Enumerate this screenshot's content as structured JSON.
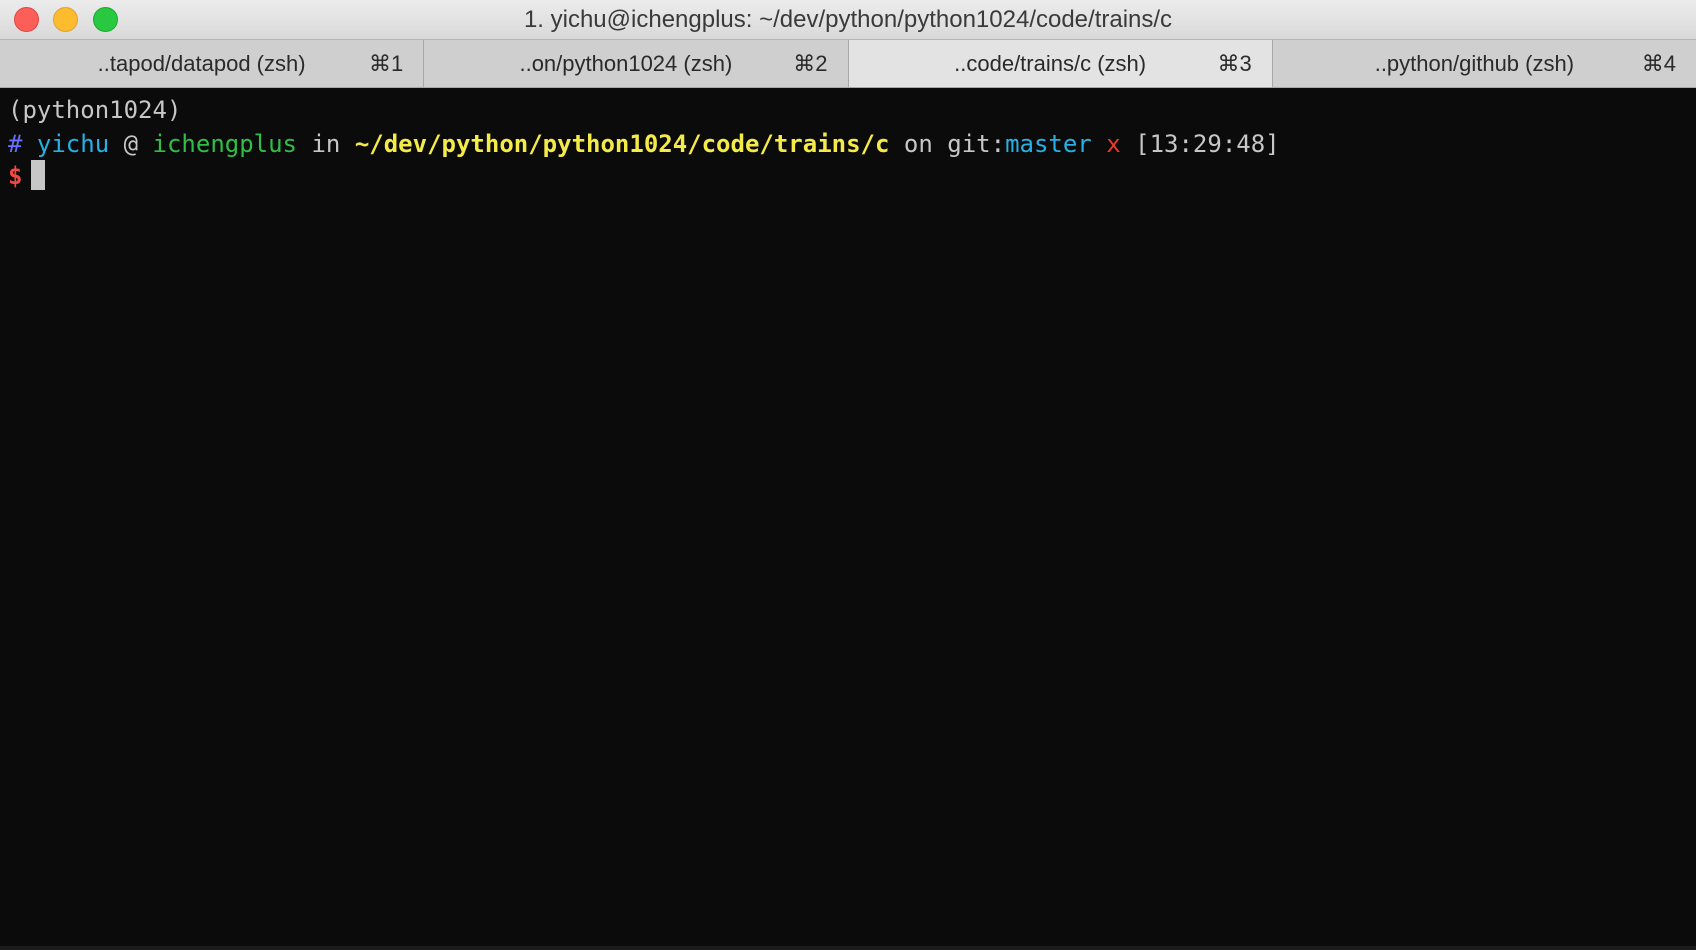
{
  "window": {
    "title": "1. yichu@ichengplus: ~/dev/python/python1024/code/trains/c",
    "controls": [
      "close-button",
      "minimize-button",
      "maximize-button"
    ]
  },
  "tabs": [
    {
      "label": "..tapod/datapod (zsh)",
      "shortcut": "⌘1",
      "active": false
    },
    {
      "label": "..on/python1024 (zsh)",
      "shortcut": "⌘2",
      "active": false
    },
    {
      "label": "..code/trains/c (zsh)",
      "shortcut": "⌘3",
      "active": true
    },
    {
      "label": "..python/github (zsh)",
      "shortcut": "⌘4",
      "active": false
    }
  ],
  "terminal": {
    "venv": "(python1024)",
    "prompt": {
      "hash": "#",
      "user": "yichu",
      "at": "@",
      "host": "ichengplus",
      "in": "in",
      "path": "~/dev/python/python1024/code/trains/c",
      "on": "on git:",
      "branch": "master",
      "dirty": "x",
      "time": "[13:29:48]",
      "dollar": "$"
    },
    "input": ""
  }
}
